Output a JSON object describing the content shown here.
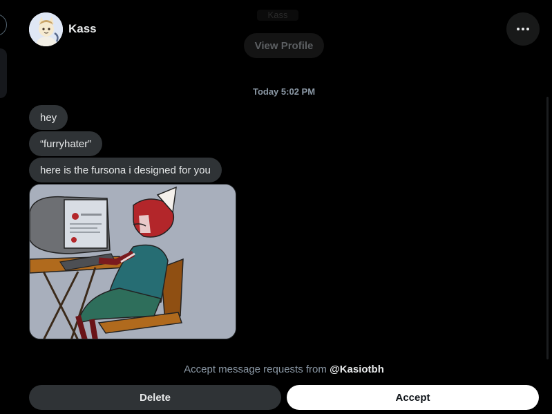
{
  "conversation": {
    "name": "Kass",
    "ghost_name": "Kass",
    "view_profile_label": "View Profile",
    "more_icon": "more-horizontal-icon"
  },
  "timestamp": "Today 5:02 PM",
  "messages": [
    {
      "text": "hey"
    },
    {
      "text": "“furryhater”"
    },
    {
      "text": "here is the fursona i designed for you"
    }
  ],
  "request": {
    "prefix": "Accept message requests from",
    "handle": "@Kasiotbh"
  },
  "actions": {
    "delete_label": "Delete",
    "accept_label": "Accept"
  },
  "colors": {
    "background": "#000000",
    "bubble": "#2f3336",
    "secondary_text": "#8b98a5",
    "accept_bg": "#ffffff"
  }
}
